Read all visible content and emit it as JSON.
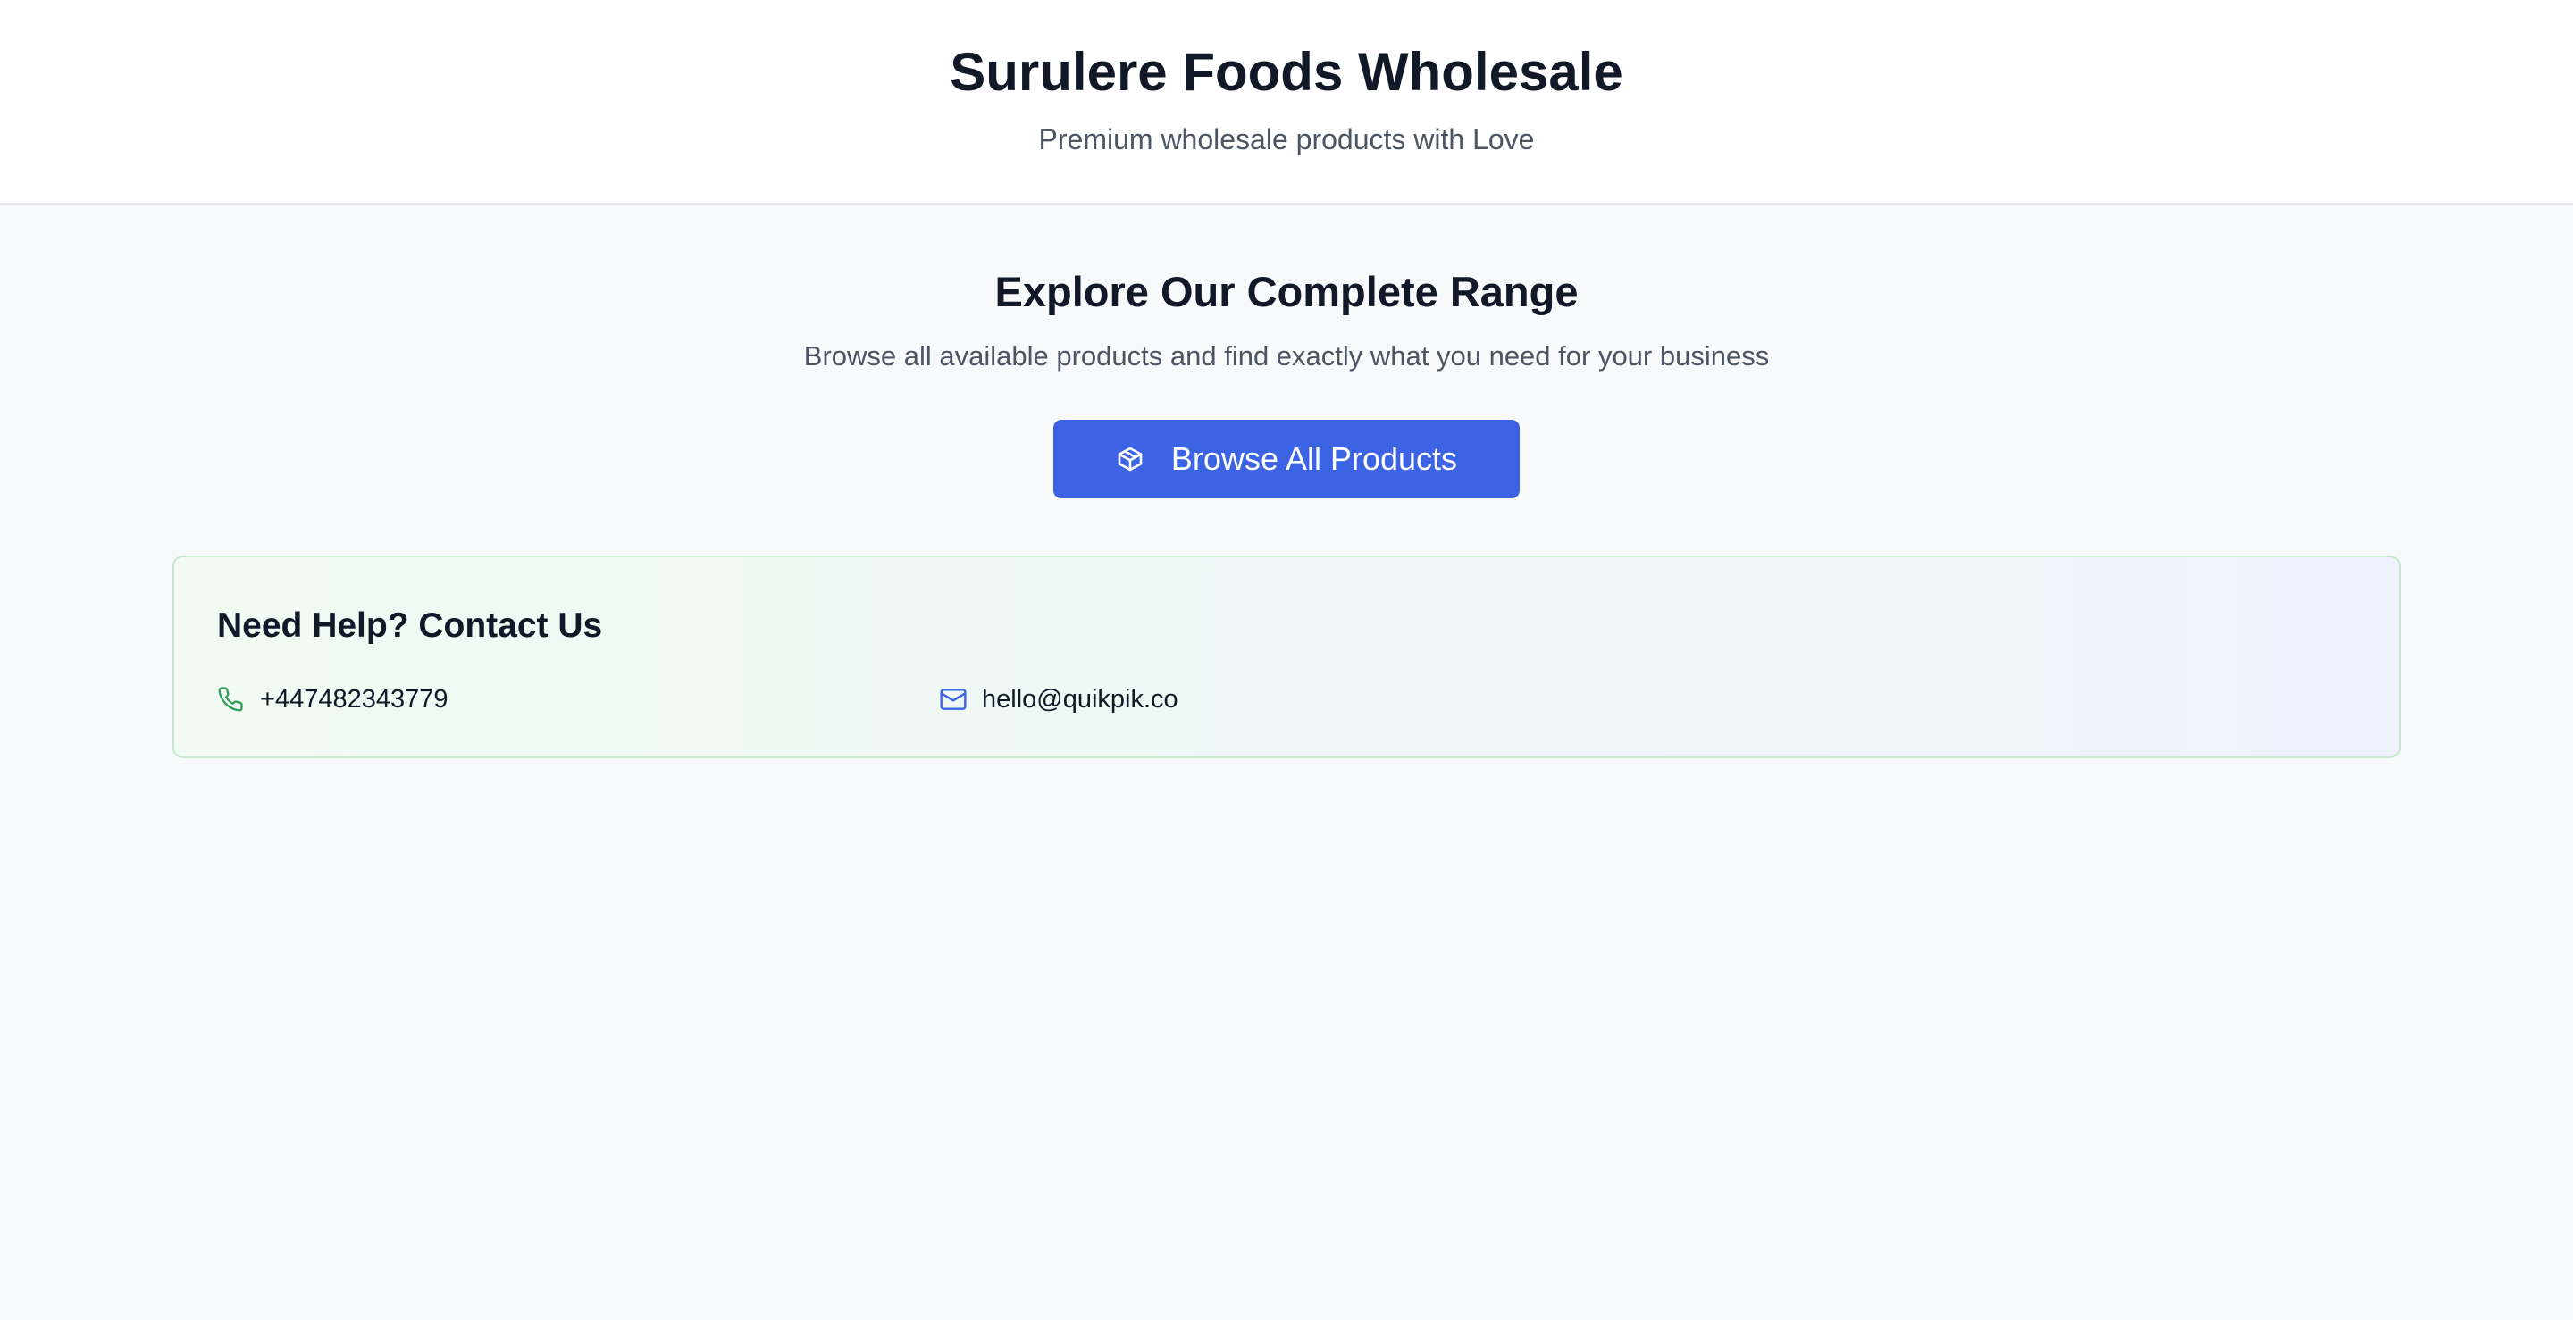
{
  "header": {
    "title": "Surulere Foods Wholesale",
    "subtitle": "Premium wholesale products with Love"
  },
  "main": {
    "title": "Explore Our Complete Range",
    "subtitle": "Browse all available products and find exactly what you need for your business",
    "browse_button": {
      "label": "Browse All Products",
      "icon": "package-icon"
    }
  },
  "contact": {
    "title": "Need Help? Contact Us",
    "phone": {
      "value": "+447482343779",
      "icon": "phone-icon"
    },
    "email": {
      "value": "hello@quikpik.co",
      "icon": "mail-icon"
    }
  },
  "colors": {
    "primary": "#3b63e4",
    "phone_icon": "#2f9e57",
    "email_icon": "#3b63e4",
    "card_border": "#c6eacf"
  }
}
